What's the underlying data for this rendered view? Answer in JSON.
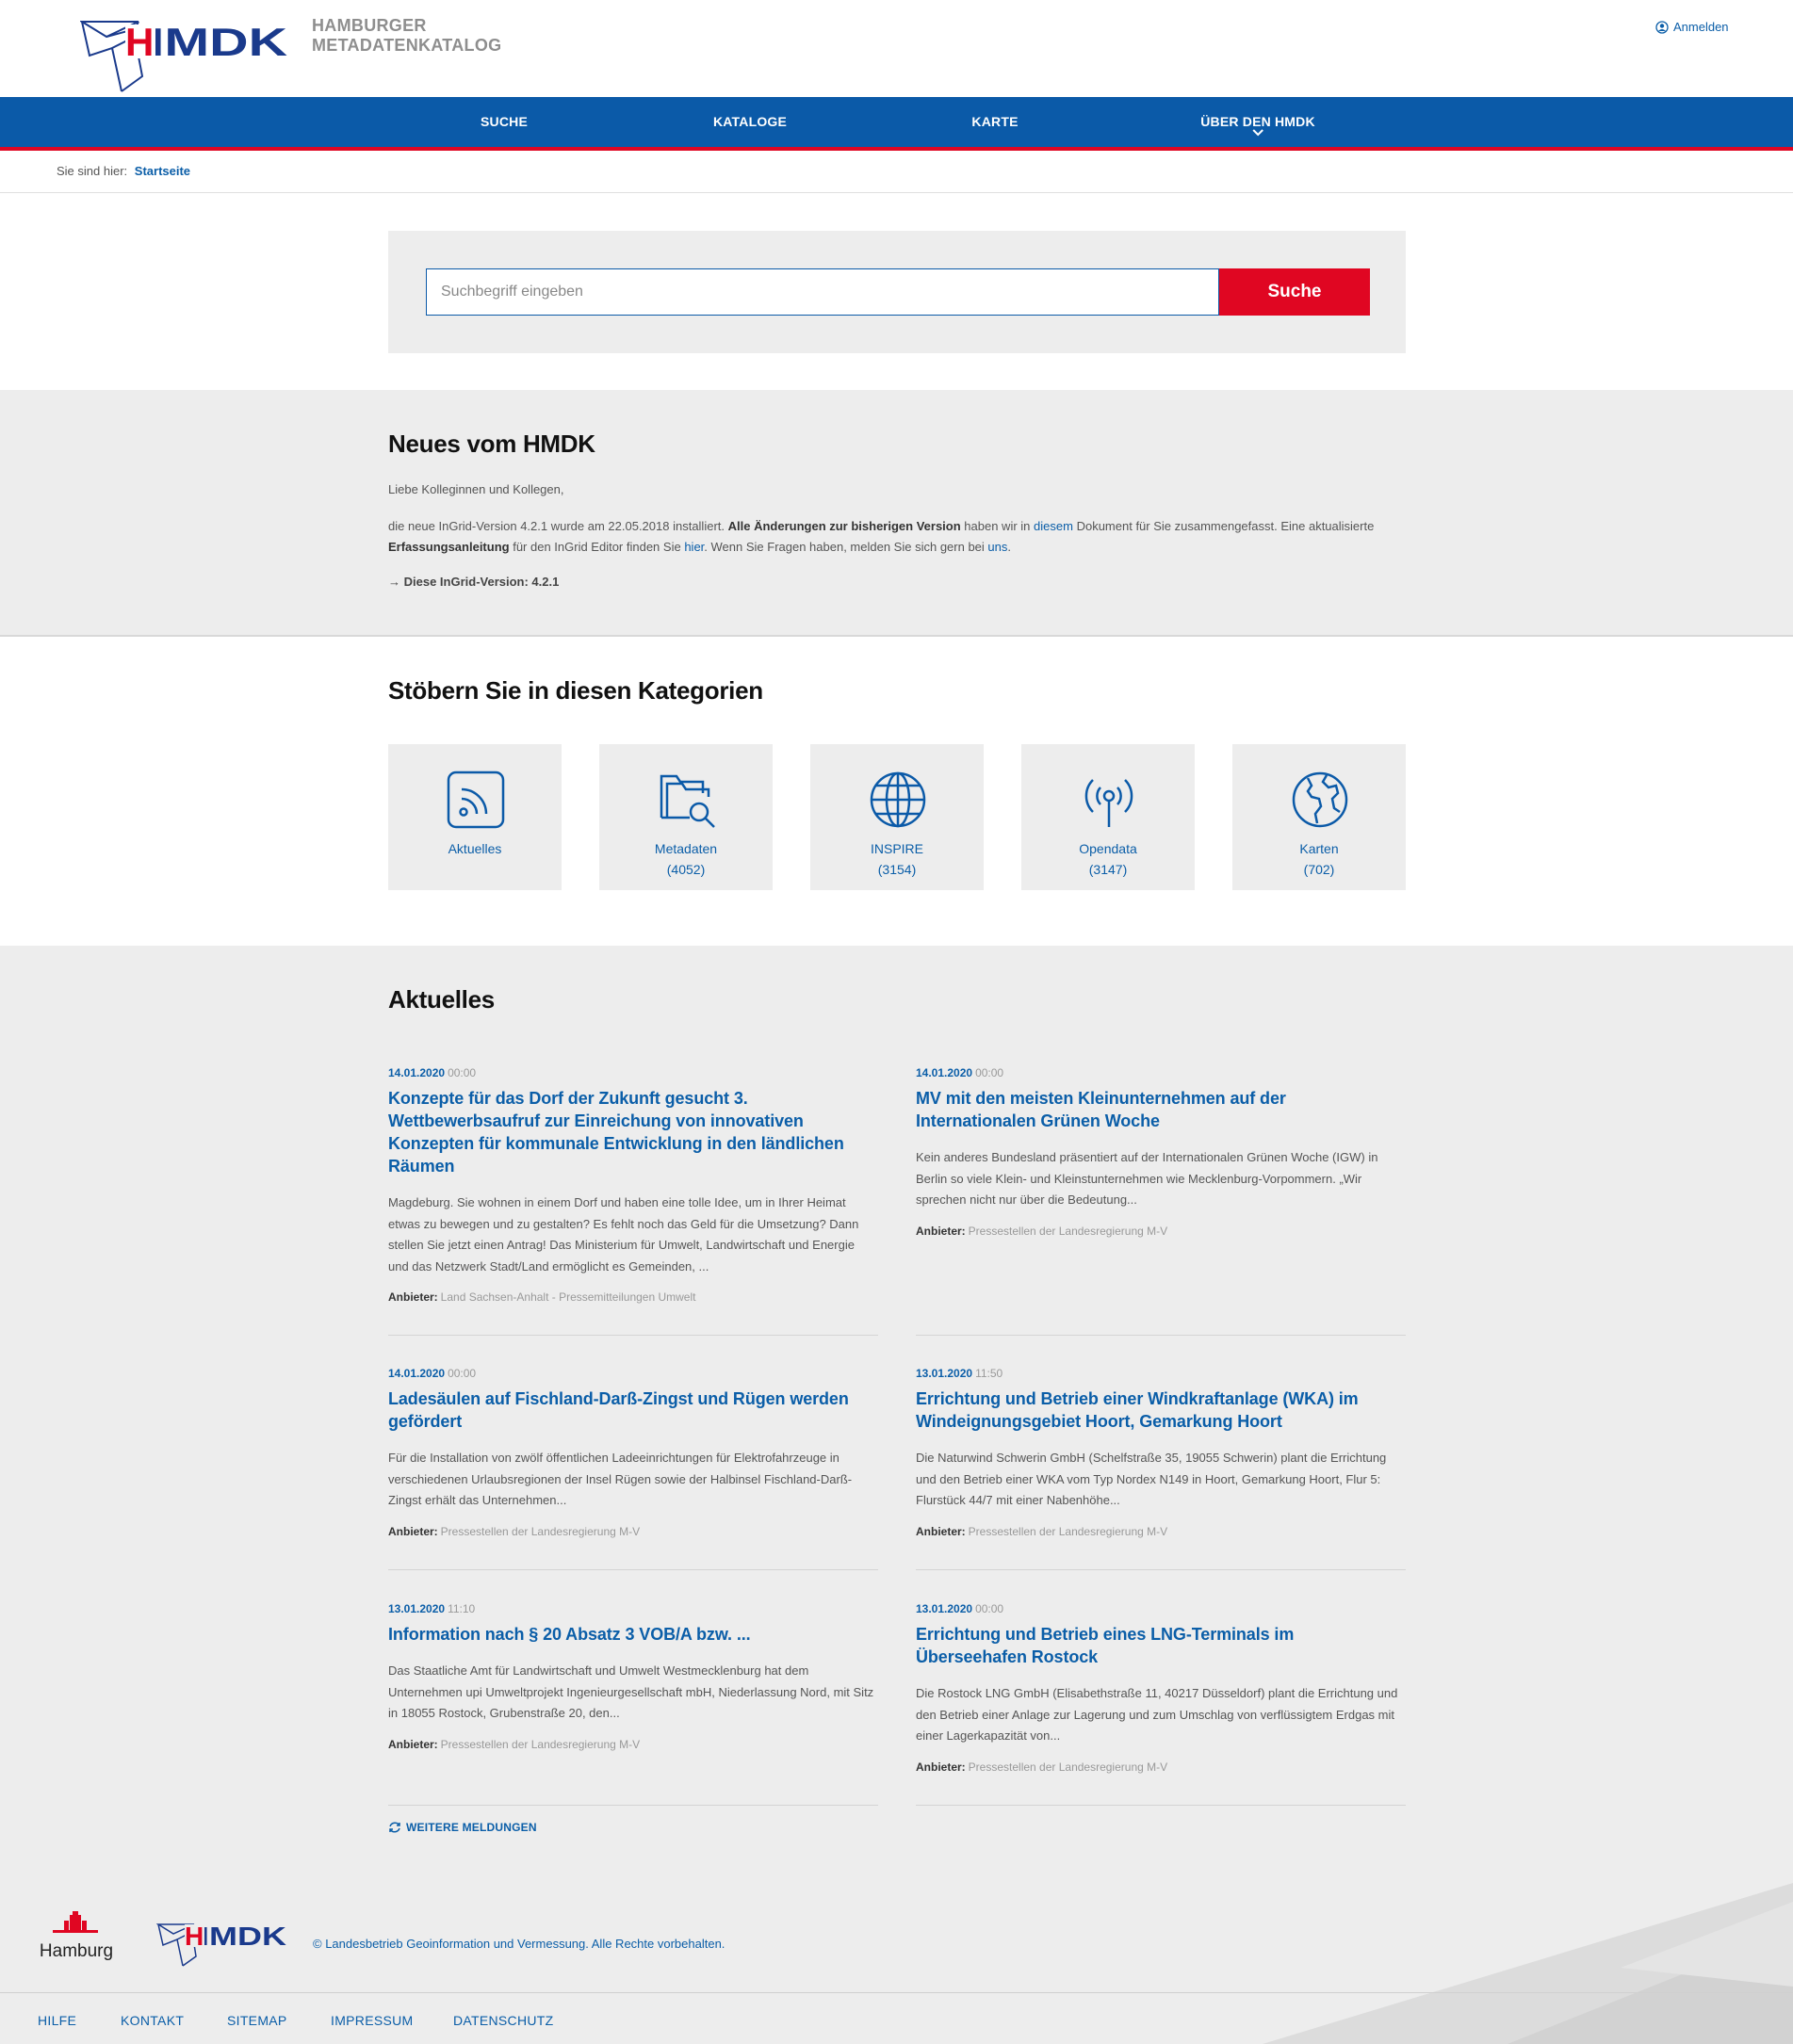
{
  "header": {
    "logo_text": "HMDK",
    "subtitle_line1": "HAMBURGER",
    "subtitle_line2": "METADATENKATALOG",
    "login_label": "Anmelden"
  },
  "nav": {
    "items": [
      {
        "label": "SUCHE"
      },
      {
        "label": "KATALOGE"
      },
      {
        "label": "KARTE"
      },
      {
        "label": "ÜBER DEN HMDK"
      }
    ]
  },
  "breadcrumb": {
    "prefix": "Sie sind hier:",
    "current": "Startseite"
  },
  "search": {
    "placeholder": "Suchbegriff eingeben",
    "button_label": "Suche"
  },
  "news": {
    "title": "Neues vom HMDK",
    "greeting": "Liebe Kolleginnen und Kollegen,",
    "t1": "die neue InGrid-Version 4.2.1 wurde am 22.05.2018 installiert.",
    "b1": "Alle Änderungen zur bisherigen Version",
    "t2": "haben wir in",
    "l1": "diesem",
    "t3": "Dokument für Sie zusammengefasst. Eine aktualisierte",
    "b2": "Erfassungsanleitung",
    "t4": "für den InGrid Editor finden Sie",
    "l2": "hier",
    "t5": ". Wenn Sie Fragen haben, melden Sie sich gern bei",
    "l3": "uns",
    "t6": ".",
    "version_line": "→ Diese InGrid-Version: 4.2.1"
  },
  "categories": {
    "title": "Stöbern Sie in diesen Kategorien",
    "items": [
      {
        "label": "Aktuelles",
        "count": "",
        "icon": "rss-icon"
      },
      {
        "label": "Metadaten",
        "count": "(4052)",
        "icon": "folder-search-icon"
      },
      {
        "label": "INSPIRE",
        "count": "(3154)",
        "icon": "globe-icon"
      },
      {
        "label": "Opendata",
        "count": "(3147)",
        "icon": "broadcast-icon"
      },
      {
        "label": "Karten",
        "count": "(702)",
        "icon": "world-map-icon"
      }
    ]
  },
  "aktuelles": {
    "title": "Aktuelles",
    "provider_label": "Anbieter:",
    "items": [
      {
        "date": "14.01.2020",
        "time": "00:00",
        "title": "Konzepte für das Dorf der Zukunft gesucht 3. Wettbewerbsaufruf zur Einreichung von innovativen Konzepten für kommunale Entwicklung in den ländlichen Räumen",
        "text": "Magdeburg. Sie wohnen in einem Dorf und haben eine tolle Idee, um in Ihrer Heimat etwas zu bewegen und zu gestalten? Es fehlt noch das Geld für die Umsetzung? Dann stellen Sie jetzt einen Antrag! Das Ministerium für Umwelt, Landwirtschaft und Energie und das Netzwerk Stadt/Land ermöglicht es Gemeinden, ...",
        "provider": "Land Sachsen-Anhalt - Pressemitteilungen Umwelt"
      },
      {
        "date": "14.01.2020",
        "time": "00:00",
        "title": "MV mit den meisten Kleinunternehmen auf der Internationalen Grünen Woche",
        "text": "Kein anderes Bundesland präsentiert auf der Internationalen Grünen Woche (IGW) in Berlin so viele Klein- und Kleinstunternehmen wie Mecklenburg-Vorpommern. „Wir sprechen nicht nur über die Bedeutung...",
        "provider": "Pressestellen der Landesregierung M-V"
      },
      {
        "date": "14.01.2020",
        "time": "00:00",
        "title": "Ladesäulen auf Fischland-Darß-Zingst und Rügen werden gefördert",
        "text": "Für die Installation von zwölf öffentlichen Ladeeinrichtungen für Elektrofahrzeuge in verschiedenen Urlaubsregionen der Insel Rügen sowie der Halbinsel Fischland-Darß-Zingst erhält das Unternehmen...",
        "provider": "Pressestellen der Landesregierung M-V"
      },
      {
        "date": "13.01.2020",
        "time": "11:50",
        "title": "Errichtung und Betrieb einer Windkraftanlage (WKA) im Windeignungsgebiet Hoort, Gemarkung Hoort",
        "text": "Die Naturwind Schwerin GmbH (Schelfstraße 35, 19055 Schwerin) plant die Errichtung und den Betrieb einer WKA vom Typ Nordex N149 in Hoort, Gemarkung Hoort, Flur 5: Flurstück 44/7 mit einer Nabenhöhe...",
        "provider": "Pressestellen der Landesregierung M-V"
      },
      {
        "date": "13.01.2020",
        "time": "11:10",
        "title": "Information nach § 20 Absatz 3 VOB/A bzw. ...",
        "text": "Das Staatliche Amt für Landwirtschaft und Umwelt Westmecklenburg hat dem Unternehmen upi Umweltprojekt Ingenieurgesellschaft mbH, Niederlassung Nord, mit Sitz in 18055 Rostock, Grubenstraße 20, den...",
        "provider": "Pressestellen der Landesregierung M-V"
      },
      {
        "date": "13.01.2020",
        "time": "00:00",
        "title": "Errichtung und Betrieb eines LNG-Terminals im Überseehafen Rostock",
        "text": "Die Rostock LNG GmbH (Elisabethstraße 11, 40217 Düsseldorf) plant die Errichtung und den Betrieb einer Anlage zur Lagerung und zum Umschlag von verflüssigtem Erdgas mit einer Lagerkapazität von...",
        "provider": "Pressestellen der Landesregierung M-V"
      }
    ],
    "more_label": "WEITERE MELDUNGEN"
  },
  "footer": {
    "hamburg_label": "Hamburg",
    "logo_text": "HMDK",
    "copyright": "© Landesbetrieb Geoinformation und Vermessung. Alle Rechte vorbehalten.",
    "links": [
      {
        "label": "HILFE"
      },
      {
        "label": "KONTAKT"
      },
      {
        "label": "SITEMAP"
      },
      {
        "label": "IMPRESSUM"
      },
      {
        "label": "DATENSCHUTZ"
      }
    ]
  },
  "colors": {
    "brand_blue": "#0b5aa8",
    "brand_red": "#e00622",
    "panel_gray": "#ededed"
  }
}
